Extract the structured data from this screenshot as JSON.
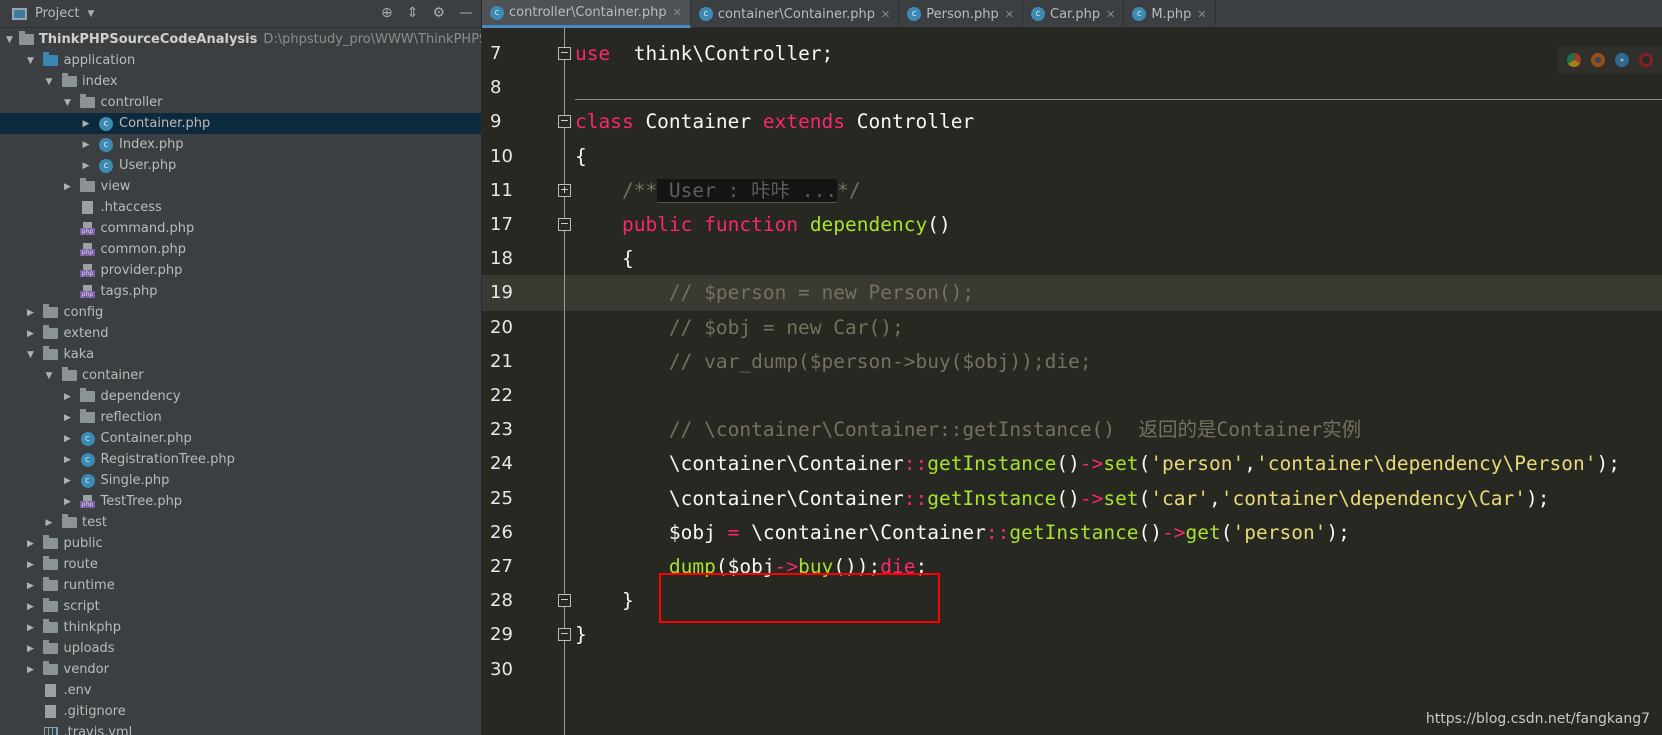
{
  "sidebar": {
    "title": "Project",
    "tree": [
      {
        "label": "ThinkPHPSourceCodeAnalysis",
        "path": "D:\\phpstudy_pro\\WWW\\ThinkPHPSourceCo",
        "level": 0,
        "icon": "folder",
        "arrow": "expanded",
        "bold": true
      },
      {
        "label": "application",
        "level": 1,
        "icon": "folder-blue",
        "arrow": "expanded"
      },
      {
        "label": "index",
        "level": 2,
        "icon": "folder",
        "arrow": "expanded"
      },
      {
        "label": "controller",
        "level": 3,
        "icon": "folder",
        "arrow": "expanded"
      },
      {
        "label": "Container.php",
        "level": 4,
        "icon": "class",
        "arrow": "collapsed",
        "selected": true
      },
      {
        "label": "Index.php",
        "level": 4,
        "icon": "class",
        "arrow": "collapsed"
      },
      {
        "label": "User.php",
        "level": 4,
        "icon": "class",
        "arrow": "collapsed"
      },
      {
        "label": "view",
        "level": 3,
        "icon": "folder",
        "arrow": "collapsed"
      },
      {
        "label": ".htaccess",
        "level": 3,
        "icon": "text"
      },
      {
        "label": "command.php",
        "level": 3,
        "icon": "php"
      },
      {
        "label": "common.php",
        "level": 3,
        "icon": "php"
      },
      {
        "label": "provider.php",
        "level": 3,
        "icon": "php"
      },
      {
        "label": "tags.php",
        "level": 3,
        "icon": "php"
      },
      {
        "label": "config",
        "level": 1,
        "icon": "folder",
        "arrow": "collapsed"
      },
      {
        "label": "extend",
        "level": 1,
        "icon": "folder",
        "arrow": "collapsed"
      },
      {
        "label": "kaka",
        "level": 1,
        "icon": "folder",
        "arrow": "expanded"
      },
      {
        "label": "container",
        "level": 2,
        "icon": "folder",
        "arrow": "expanded"
      },
      {
        "label": "dependency",
        "level": 3,
        "icon": "folder",
        "arrow": "collapsed"
      },
      {
        "label": "reflection",
        "level": 3,
        "icon": "folder",
        "arrow": "collapsed"
      },
      {
        "label": "Container.php",
        "level": 3,
        "icon": "class",
        "arrow": "collapsed"
      },
      {
        "label": "RegistrationTree.php",
        "level": 3,
        "icon": "class",
        "arrow": "collapsed"
      },
      {
        "label": "Single.php",
        "level": 3,
        "icon": "class",
        "arrow": "collapsed"
      },
      {
        "label": "TestTree.php",
        "level": 3,
        "icon": "php",
        "arrow": "collapsed"
      },
      {
        "label": "test",
        "level": 2,
        "icon": "folder",
        "arrow": "collapsed"
      },
      {
        "label": "public",
        "level": 1,
        "icon": "folder",
        "arrow": "collapsed"
      },
      {
        "label": "route",
        "level": 1,
        "icon": "folder",
        "arrow": "collapsed"
      },
      {
        "label": "runtime",
        "level": 1,
        "icon": "folder",
        "arrow": "collapsed"
      },
      {
        "label": "script",
        "level": 1,
        "icon": "folder",
        "arrow": "collapsed"
      },
      {
        "label": "thinkphp",
        "level": 1,
        "icon": "folder",
        "arrow": "collapsed"
      },
      {
        "label": "uploads",
        "level": 1,
        "icon": "folder",
        "arrow": "collapsed"
      },
      {
        "label": "vendor",
        "level": 1,
        "icon": "folder",
        "arrow": "collapsed"
      },
      {
        "label": ".env",
        "level": 1,
        "icon": "text"
      },
      {
        "label": ".gitignore",
        "level": 1,
        "icon": "text"
      },
      {
        "label": ".travis.yml",
        "level": 1,
        "icon": "yml"
      }
    ]
  },
  "tabs": [
    {
      "label": "controller\\Container.php",
      "active": true
    },
    {
      "label": "container\\Container.php"
    },
    {
      "label": "Person.php"
    },
    {
      "label": "Car.php"
    },
    {
      "label": "M.php"
    }
  ],
  "editor": {
    "current_line": "19",
    "lines": [
      {
        "n": "7",
        "fold": "-",
        "tokens": [
          [
            "k",
            "use"
          ],
          [
            "",
            "  think\\Controller;"
          ]
        ]
      },
      {
        "n": "8",
        "tokens": []
      },
      {
        "n": "9",
        "fold": "-",
        "tokens": [
          [
            "k",
            "class"
          ],
          [
            "",
            " Container "
          ],
          [
            "k",
            "extends"
          ],
          [
            "",
            " Controller"
          ]
        ]
      },
      {
        "n": "10",
        "tokens": [
          [
            "",
            "{"
          ]
        ]
      },
      {
        "n": "11",
        "fold": "+",
        "tokens": [
          [
            "c",
            "    /**"
          ],
          [
            "folded",
            " User : 咔咔 ..."
          ],
          [
            "c",
            "*/"
          ]
        ]
      },
      {
        "n": "17",
        "fold": "-",
        "tokens": [
          [
            "k",
            "    public function "
          ],
          [
            "f",
            "dependency"
          ],
          [
            "",
            "()"
          ]
        ]
      },
      {
        "n": "18",
        "tokens": [
          [
            "",
            "    {"
          ]
        ]
      },
      {
        "n": "19",
        "tokens": [
          [
            "c",
            "        // $person = new Person();"
          ]
        ]
      },
      {
        "n": "20",
        "tokens": [
          [
            "c",
            "        // $obj = new Car();"
          ]
        ]
      },
      {
        "n": "21",
        "tokens": [
          [
            "c",
            "        // var_dump($person->buy($obj));die;"
          ]
        ]
      },
      {
        "n": "22",
        "tokens": []
      },
      {
        "n": "23",
        "tokens": [
          [
            "c",
            "        // \\container\\Container::getInstance()  返回的是Container实例"
          ]
        ]
      },
      {
        "n": "24",
        "tokens": [
          [
            "",
            "        \\container\\Container"
          ],
          [
            "o",
            "::"
          ],
          [
            "f",
            "getInstance"
          ],
          [
            "",
            "()"
          ],
          [
            "o",
            "->"
          ],
          [
            "f",
            "set"
          ],
          [
            "",
            "("
          ],
          [
            "s",
            "'person'"
          ],
          [
            ",",
            ","
          ],
          [
            "s",
            "'container\\dependency\\Person'"
          ],
          [
            "",
            ");"
          ]
        ]
      },
      {
        "n": "25",
        "tokens": [
          [
            "",
            "        \\container\\Container"
          ],
          [
            "o",
            "::"
          ],
          [
            "f",
            "getInstance"
          ],
          [
            "",
            "()"
          ],
          [
            "o",
            "->"
          ],
          [
            "f",
            "set"
          ],
          [
            "",
            "("
          ],
          [
            "s",
            "'car'"
          ],
          [
            "",
            ","
          ],
          [
            "s",
            "'container\\dependency\\Car'"
          ],
          [
            "",
            ");"
          ]
        ]
      },
      {
        "n": "26",
        "tokens": [
          [
            "",
            "        $obj "
          ],
          [
            "o",
            "="
          ],
          [
            "",
            " \\container\\Container"
          ],
          [
            "o",
            "::"
          ],
          [
            "f",
            "getInstance"
          ],
          [
            "",
            "()"
          ],
          [
            "o",
            "->"
          ],
          [
            "f",
            "get"
          ],
          [
            "",
            "("
          ],
          [
            "s",
            "'person'"
          ],
          [
            "",
            ");"
          ]
        ]
      },
      {
        "n": "27",
        "tokens": [
          [
            "f",
            "        dump"
          ],
          [
            "",
            "($obj"
          ],
          [
            "o",
            "->"
          ],
          [
            "f",
            "buy"
          ],
          [
            "",
            "());"
          ],
          [
            "k",
            "die"
          ],
          [
            "",
            ";"
          ]
        ]
      },
      {
        "n": "28",
        "fold": "-",
        "tokens": [
          [
            "",
            "    }"
          ]
        ]
      },
      {
        "n": "29",
        "fold": "-",
        "tokens": [
          [
            "",
            "}"
          ]
        ]
      },
      {
        "n": "30",
        "tokens": []
      }
    ]
  },
  "browsers": [
    "chrome",
    "firefox",
    "safari",
    "opera"
  ],
  "colors": {
    "keyword": "#f92672",
    "function": "#a6e22e",
    "string": "#e6db74",
    "comment": "#75715e",
    "highlight_box": "#ff0000"
  },
  "watermark": "https://blog.csdn.net/fangkang7"
}
